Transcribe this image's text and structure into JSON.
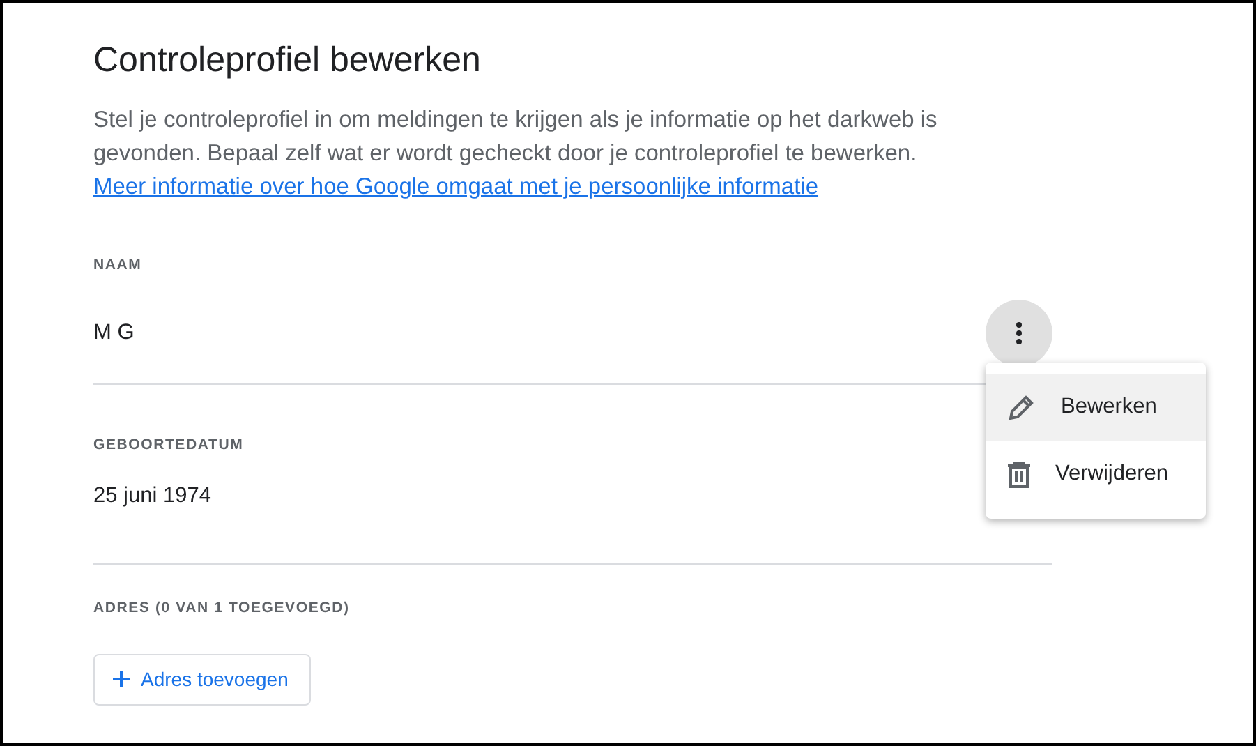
{
  "title": "Controleprofiel bewerken",
  "description": "Stel je controleprofiel in om meldingen te krijgen als je informatie op het darkweb is gevonden. Bepaal zelf wat er wordt gecheckt door je controleprofiel te bewerken.",
  "info_link": "Meer informatie over hoe Google omgaat met je persoonlijke informatie",
  "fields": [
    {
      "label": "NAAM",
      "value": "M G",
      "menu_open": true
    },
    {
      "label": "GEBOORTEDATUM",
      "value": "25 juni 1974",
      "menu_open": false
    }
  ],
  "address": {
    "label": "ADRES (0 VAN 1 TOEGEVOEGD)",
    "button": "Adres toevoegen"
  },
  "menu": [
    {
      "kind": "edit",
      "label": "Bewerken",
      "highlighted": true
    },
    {
      "kind": "delete",
      "label": "Verwijderen",
      "highlighted": false
    }
  ]
}
